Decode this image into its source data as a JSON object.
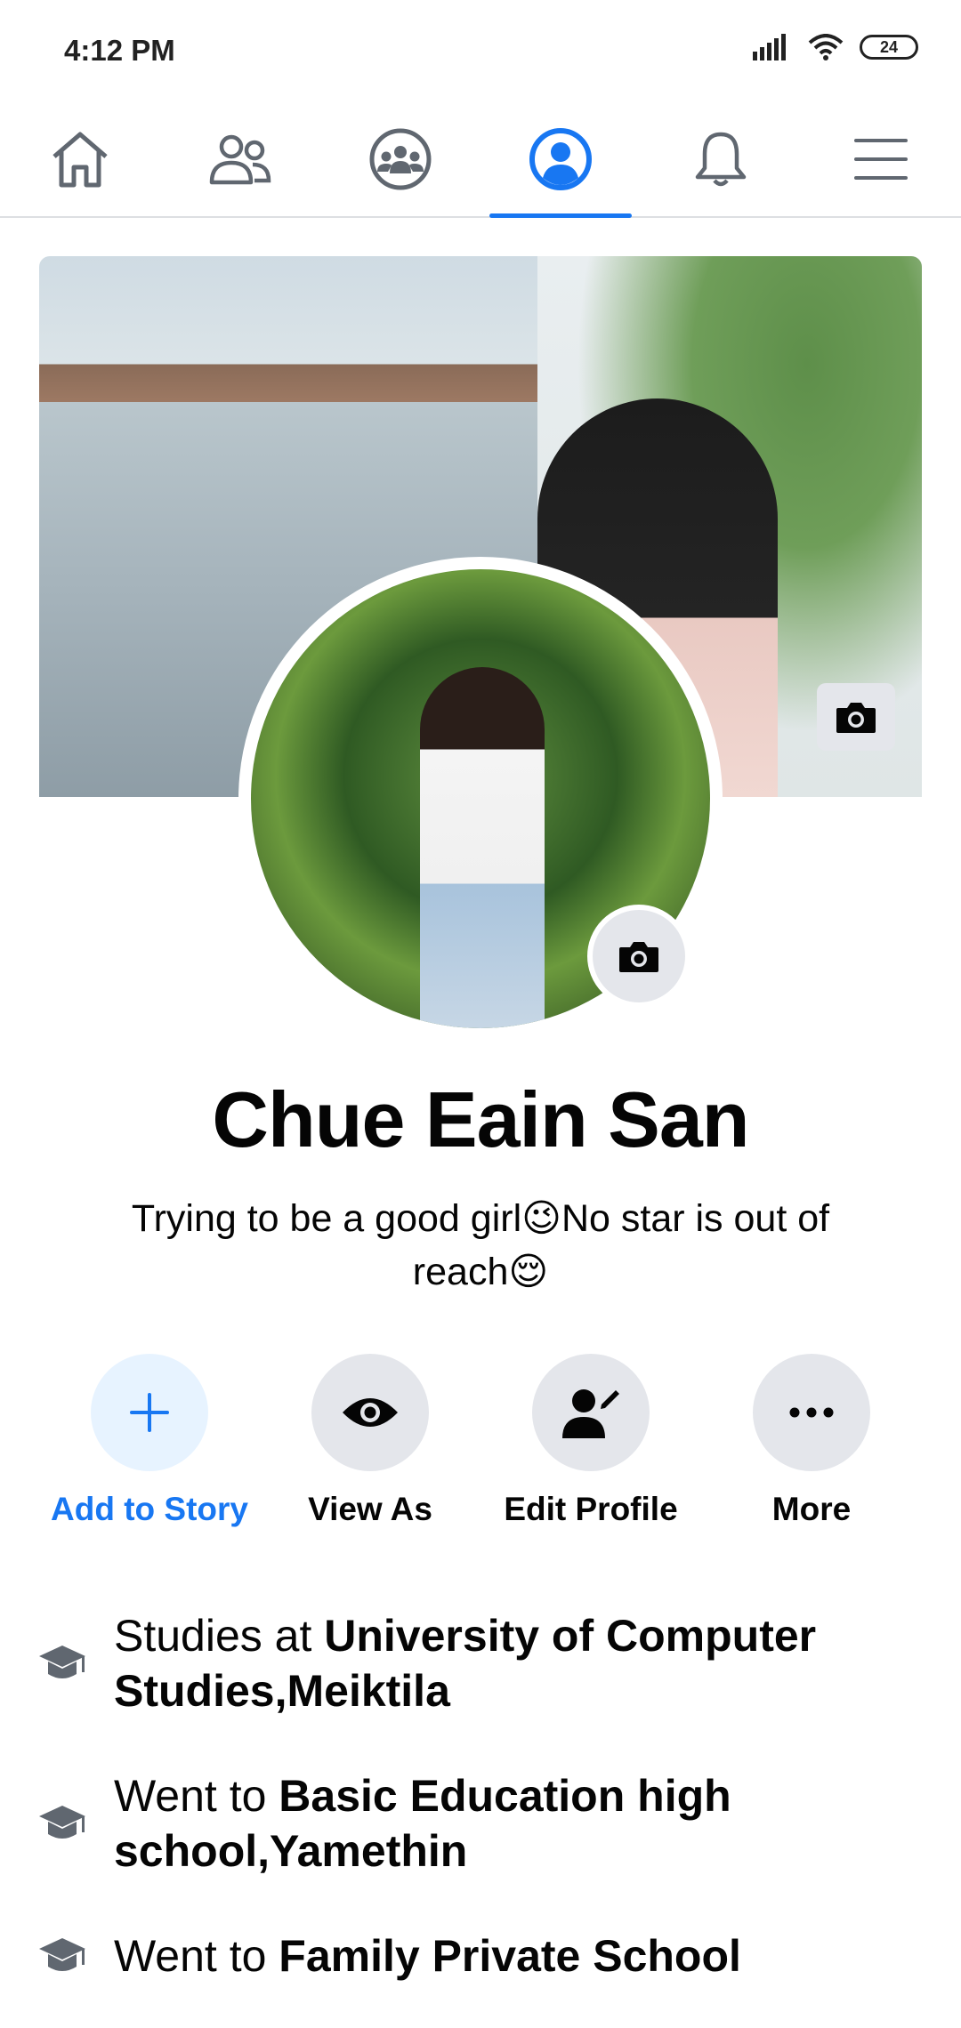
{
  "status_bar": {
    "time": "4:12 PM",
    "battery": "24"
  },
  "nav": {
    "tabs": [
      {
        "name": "home",
        "icon": "home-icon"
      },
      {
        "name": "friends",
        "icon": "friends-icon"
      },
      {
        "name": "groups",
        "icon": "groups-icon"
      },
      {
        "name": "profile",
        "icon": "profile-icon",
        "active": true
      },
      {
        "name": "notifications",
        "icon": "bell-icon"
      },
      {
        "name": "menu",
        "icon": "hamburger-menu-icon"
      }
    ],
    "accent": "#1877f2"
  },
  "profile": {
    "name": "Chue Eain San",
    "bio_part1": "Trying to be a good girl",
    "bio_emoji1": "😉",
    "bio_part2": "No star is out of reach",
    "bio_emoji2": "😌"
  },
  "actions": {
    "add_to_story": "Add to Story",
    "view_as": "View As",
    "edit_profile": "Edit Profile",
    "more": "More"
  },
  "details": [
    {
      "prefix": "Studies at ",
      "place": "University of Computer Studies,Meiktila",
      "icon": "graduation-cap-icon"
    },
    {
      "prefix": "Went to ",
      "place": "Basic Education high school,Yamethin",
      "icon": "graduation-cap-icon"
    },
    {
      "prefix": "Went to ",
      "place": "Family Private School",
      "icon": "graduation-cap-icon"
    }
  ]
}
